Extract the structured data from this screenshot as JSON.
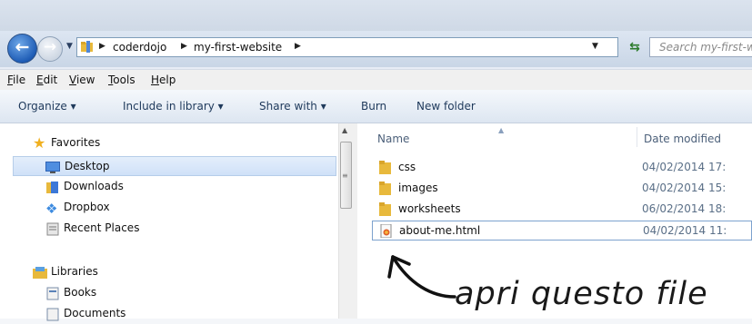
{
  "address": {
    "crumbs": [
      "coderdojo",
      "my-first-website"
    ],
    "search_placeholder": "Search my-first-w"
  },
  "menu": [
    {
      "accel": "F",
      "rest": "ile"
    },
    {
      "accel": "E",
      "rest": "dit"
    },
    {
      "accel": "V",
      "rest": "iew"
    },
    {
      "accel": "T",
      "rest": "ools"
    },
    {
      "accel": "H",
      "rest": "elp"
    }
  ],
  "commands": {
    "organize": "Organize ▾",
    "include": "Include in library ▾",
    "share": "Share with ▾",
    "burn": "Burn",
    "new_folder": "New folder"
  },
  "nav": {
    "favorites": "Favorites",
    "desktop": "Desktop",
    "downloads": "Downloads",
    "dropbox": "Dropbox",
    "recent": "Recent Places",
    "libraries": "Libraries",
    "books": "Books",
    "documents": "Documents"
  },
  "columns": {
    "name": "Name",
    "date": "Date modified"
  },
  "files": [
    {
      "name": "css",
      "date": "04/02/2014 17:"
    },
    {
      "name": "images",
      "date": "04/02/2014 15:"
    },
    {
      "name": "worksheets",
      "date": "06/02/2014 18:"
    },
    {
      "name": "about-me.html",
      "date": "04/02/2014 11:"
    }
  ],
  "annotation": "apri questo file",
  "colors": {
    "accent": "#1f5db6",
    "selection": "#cfe1f8",
    "folder": "#e8b93c"
  }
}
